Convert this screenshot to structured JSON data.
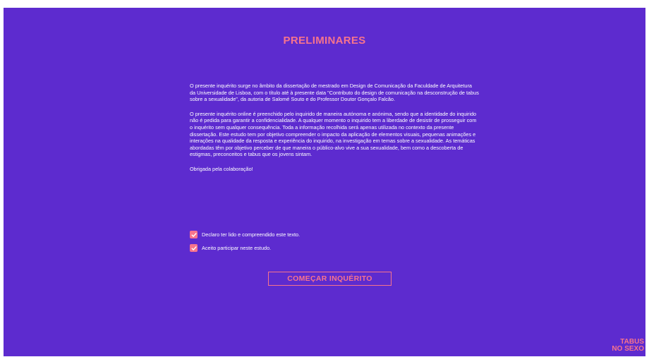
{
  "page": {
    "title": "PRELIMINARES",
    "paragraphs": [
      "O presente inquérito surge no âmbito da dissertação de mestrado em Design de Comunicação da Faculdade de Arquitetura da Universidade de Lisboa, com o título até à presente data \"Contributo do design de comunicação na desconstrução de tabus sobre a sexualidade\", da autoria de Salomé Souto e do Professor Doutor Gonçalo Falcão.",
      "O presente inquérito online é preenchido pelo inquirido de maneira autónoma e anónima, sendo que a identidade do inquirido não é pedida para garantir a confidencialidade. A qualquer momento o inquirido tem a liberdade de desistir de prosseguir com o inquérito sem qualquer consequência. Toda a informação recolhida será apenas utilizada no contexto da presente dissertação. Este estudo tem por objetivo compreender o impacto da aplicação de elementos visuais, pequenas animações e interações na qualidade da resposta e experiência do inquirido, na investigação em temas sobre a sexualidade. As temáticas abordadas têm por objetivo perceber de que maneira o público-alvo vive a sua sexualidade, bem como a descoberta de estigmas, preconceitos e tabus que os jovens sintam.",
      "Obrigada pela colaboração!"
    ],
    "checkboxes": [
      {
        "label": "Declaro ter lido e compreendido este texto.",
        "checked": true
      },
      {
        "label": "Aceito participar neste estudo.",
        "checked": true
      }
    ],
    "start_button": "COMEÇAR INQUÉRITO",
    "logo": {
      "line1": "TABUS",
      "line2": "NO SEXO"
    },
    "colors": {
      "background": "#5d2bcf",
      "accent": "#f7748c",
      "text": "#ffffff"
    }
  }
}
